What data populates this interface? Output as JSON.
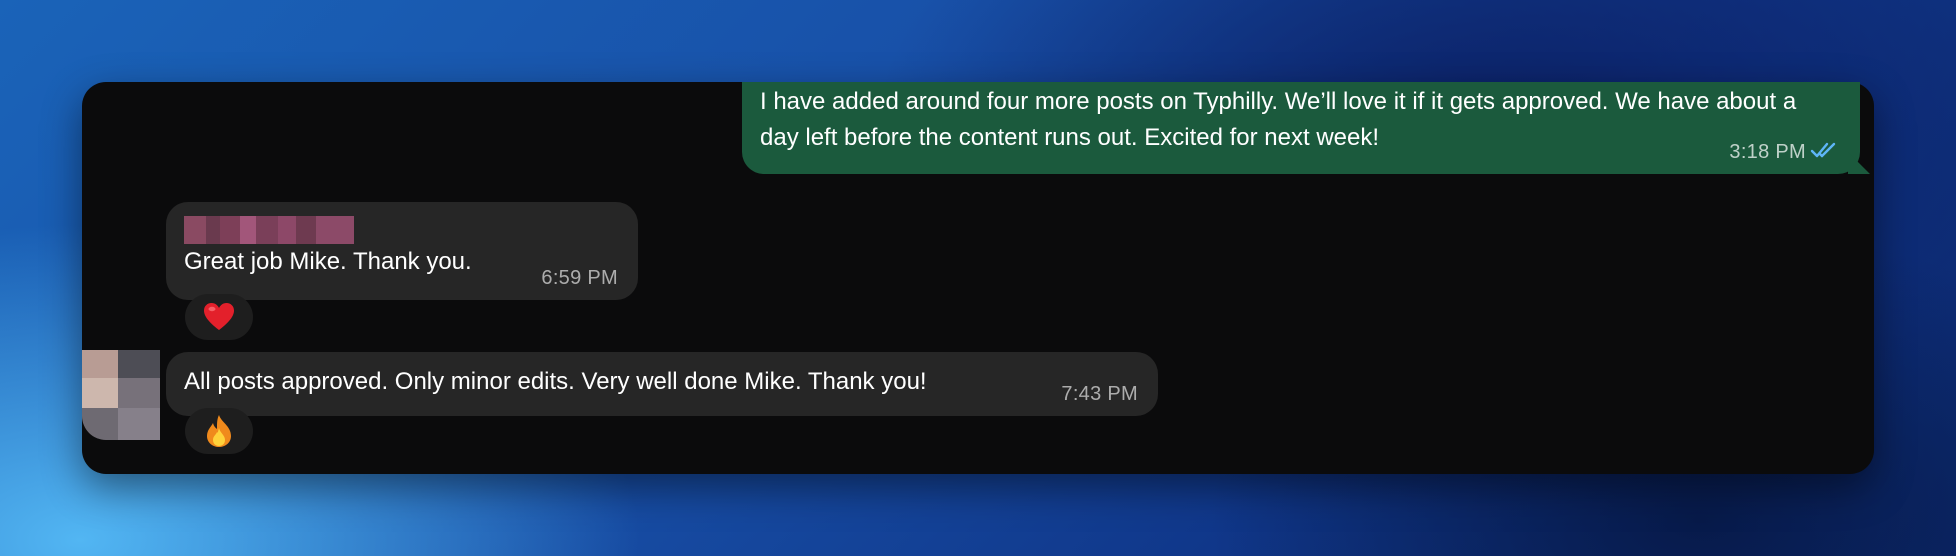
{
  "conversation": {
    "messages": [
      {
        "direction": "outgoing",
        "text": "I have added around four more posts on Typhilly. We’ll love it if it gets approved. We have about a day left before the content runs out. Excited for next week!",
        "time": "3:18 PM",
        "status_icon": "double-check-icon",
        "status_color": "#5eb5f7"
      },
      {
        "direction": "incoming",
        "sender_name_blurred": true,
        "text": "Great job Mike. Thank you.",
        "time": "6:59 PM",
        "reaction": "❤️"
      },
      {
        "direction": "incoming",
        "text": "All posts approved. Only minor edits. Very well done Mike. Thank you!",
        "time": "7:43 PM",
        "reaction": "🔥",
        "avatar_blurred": true
      }
    ]
  },
  "colors": {
    "window_bg": "#0b0b0c",
    "outgoing_bubble": "#1b5a3d",
    "incoming_bubble": "#262626",
    "reaction_bg": "#1e1e1e"
  }
}
